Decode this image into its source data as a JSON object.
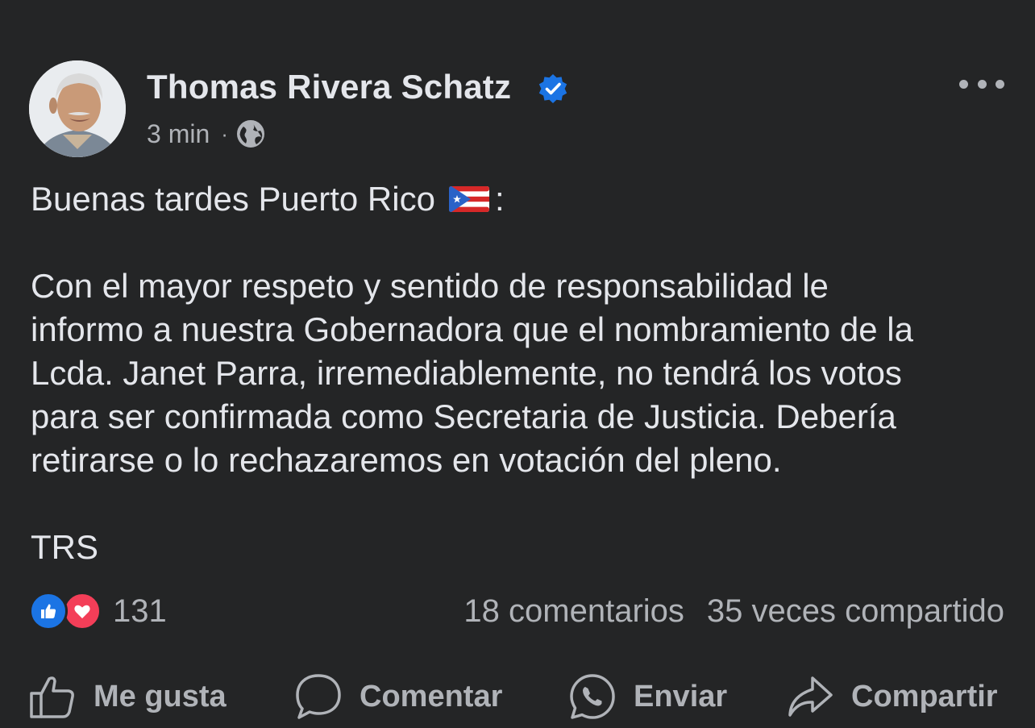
{
  "post": {
    "author": "Thomas Rivera Schatz",
    "time": "3 min",
    "separator": "·",
    "icons": {
      "verified": "verified-badge-icon",
      "privacy": "globe-icon",
      "menu": "more-options-icon"
    },
    "greeting": "Buenas tardes Puerto Rico",
    "greeting_suffix": ":",
    "body_lines": [
      "Con el mayor respeto y sentido de responsabilidad le",
      "informo a nuestra Gobernadora que el nombramiento de la",
      "Lcda. Janet Parra, irremediablemente, no tendrá los votos",
      "para ser confirmada como Secretaria de Justicia. Debería",
      "retirarse o lo rechazaremos en votación del pleno."
    ],
    "signature": "TRS"
  },
  "stats": {
    "reaction_count": "131",
    "comments": "18 comentarios",
    "shares": "35 veces compartido"
  },
  "actions": {
    "like": "Me gusta",
    "comment": "Comentar",
    "send": "Enviar",
    "share": "Compartir"
  },
  "colors": {
    "background": "#242526",
    "primary_text": "#e4e6eb",
    "secondary_text": "#b0b3b8",
    "verified_blue": "#1b74e4",
    "like_blue": "#1b74e4",
    "love_red": "#f33e58"
  }
}
